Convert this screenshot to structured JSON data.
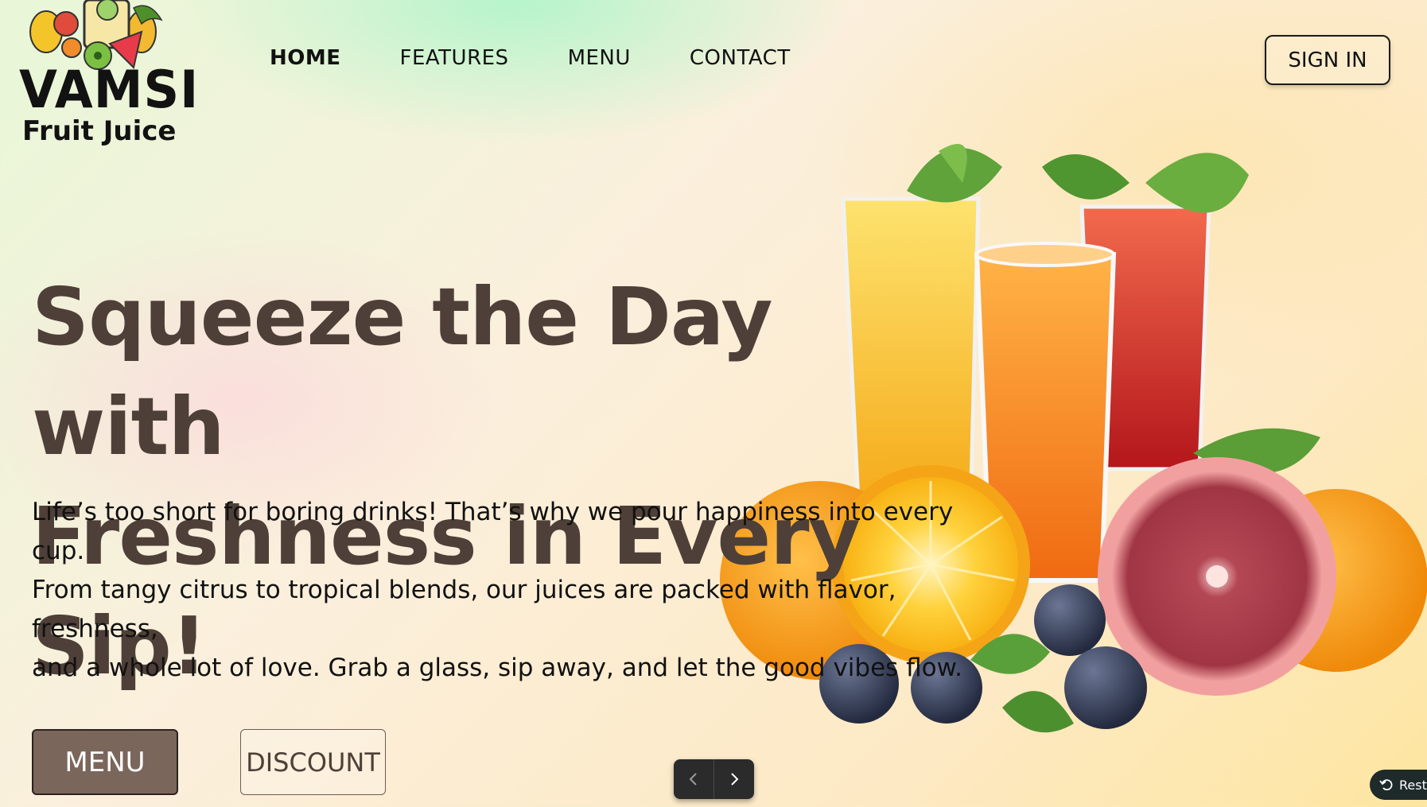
{
  "brand": {
    "name": "VAMSI",
    "tagline": "Fruit Juice"
  },
  "nav": {
    "items": [
      {
        "label": "HOME",
        "active": true
      },
      {
        "label": "FEATURES",
        "active": false
      },
      {
        "label": "MENU",
        "active": false
      },
      {
        "label": "CONTACT",
        "active": false
      }
    ],
    "sign_in_label": "SIGN IN"
  },
  "hero": {
    "title_line1": "Squeeze the Day with",
    "title_line2": "Freshness in Every Sip!",
    "copy_line1": "Life’s too short for boring drinks! That’s why we pour happiness into every cup.",
    "copy_line2": "From tangy citrus to tropical blends, our juices are packed with flavor, freshness,",
    "copy_line3": "and a whole lot of love. Grab a glass, sip away, and let the good vibes flow.",
    "menu_button": "MENU",
    "discount_button": "DISCOUNT"
  },
  "pager": {
    "prev_icon": "chevron-left-icon",
    "next_icon": "chevron-right-icon"
  },
  "restore": {
    "label": "Resta",
    "icon": "undo-icon"
  },
  "colors": {
    "title": "#4e4038",
    "menu_button_bg": "#7b665b",
    "pager_bg": "#2b2b2b"
  }
}
